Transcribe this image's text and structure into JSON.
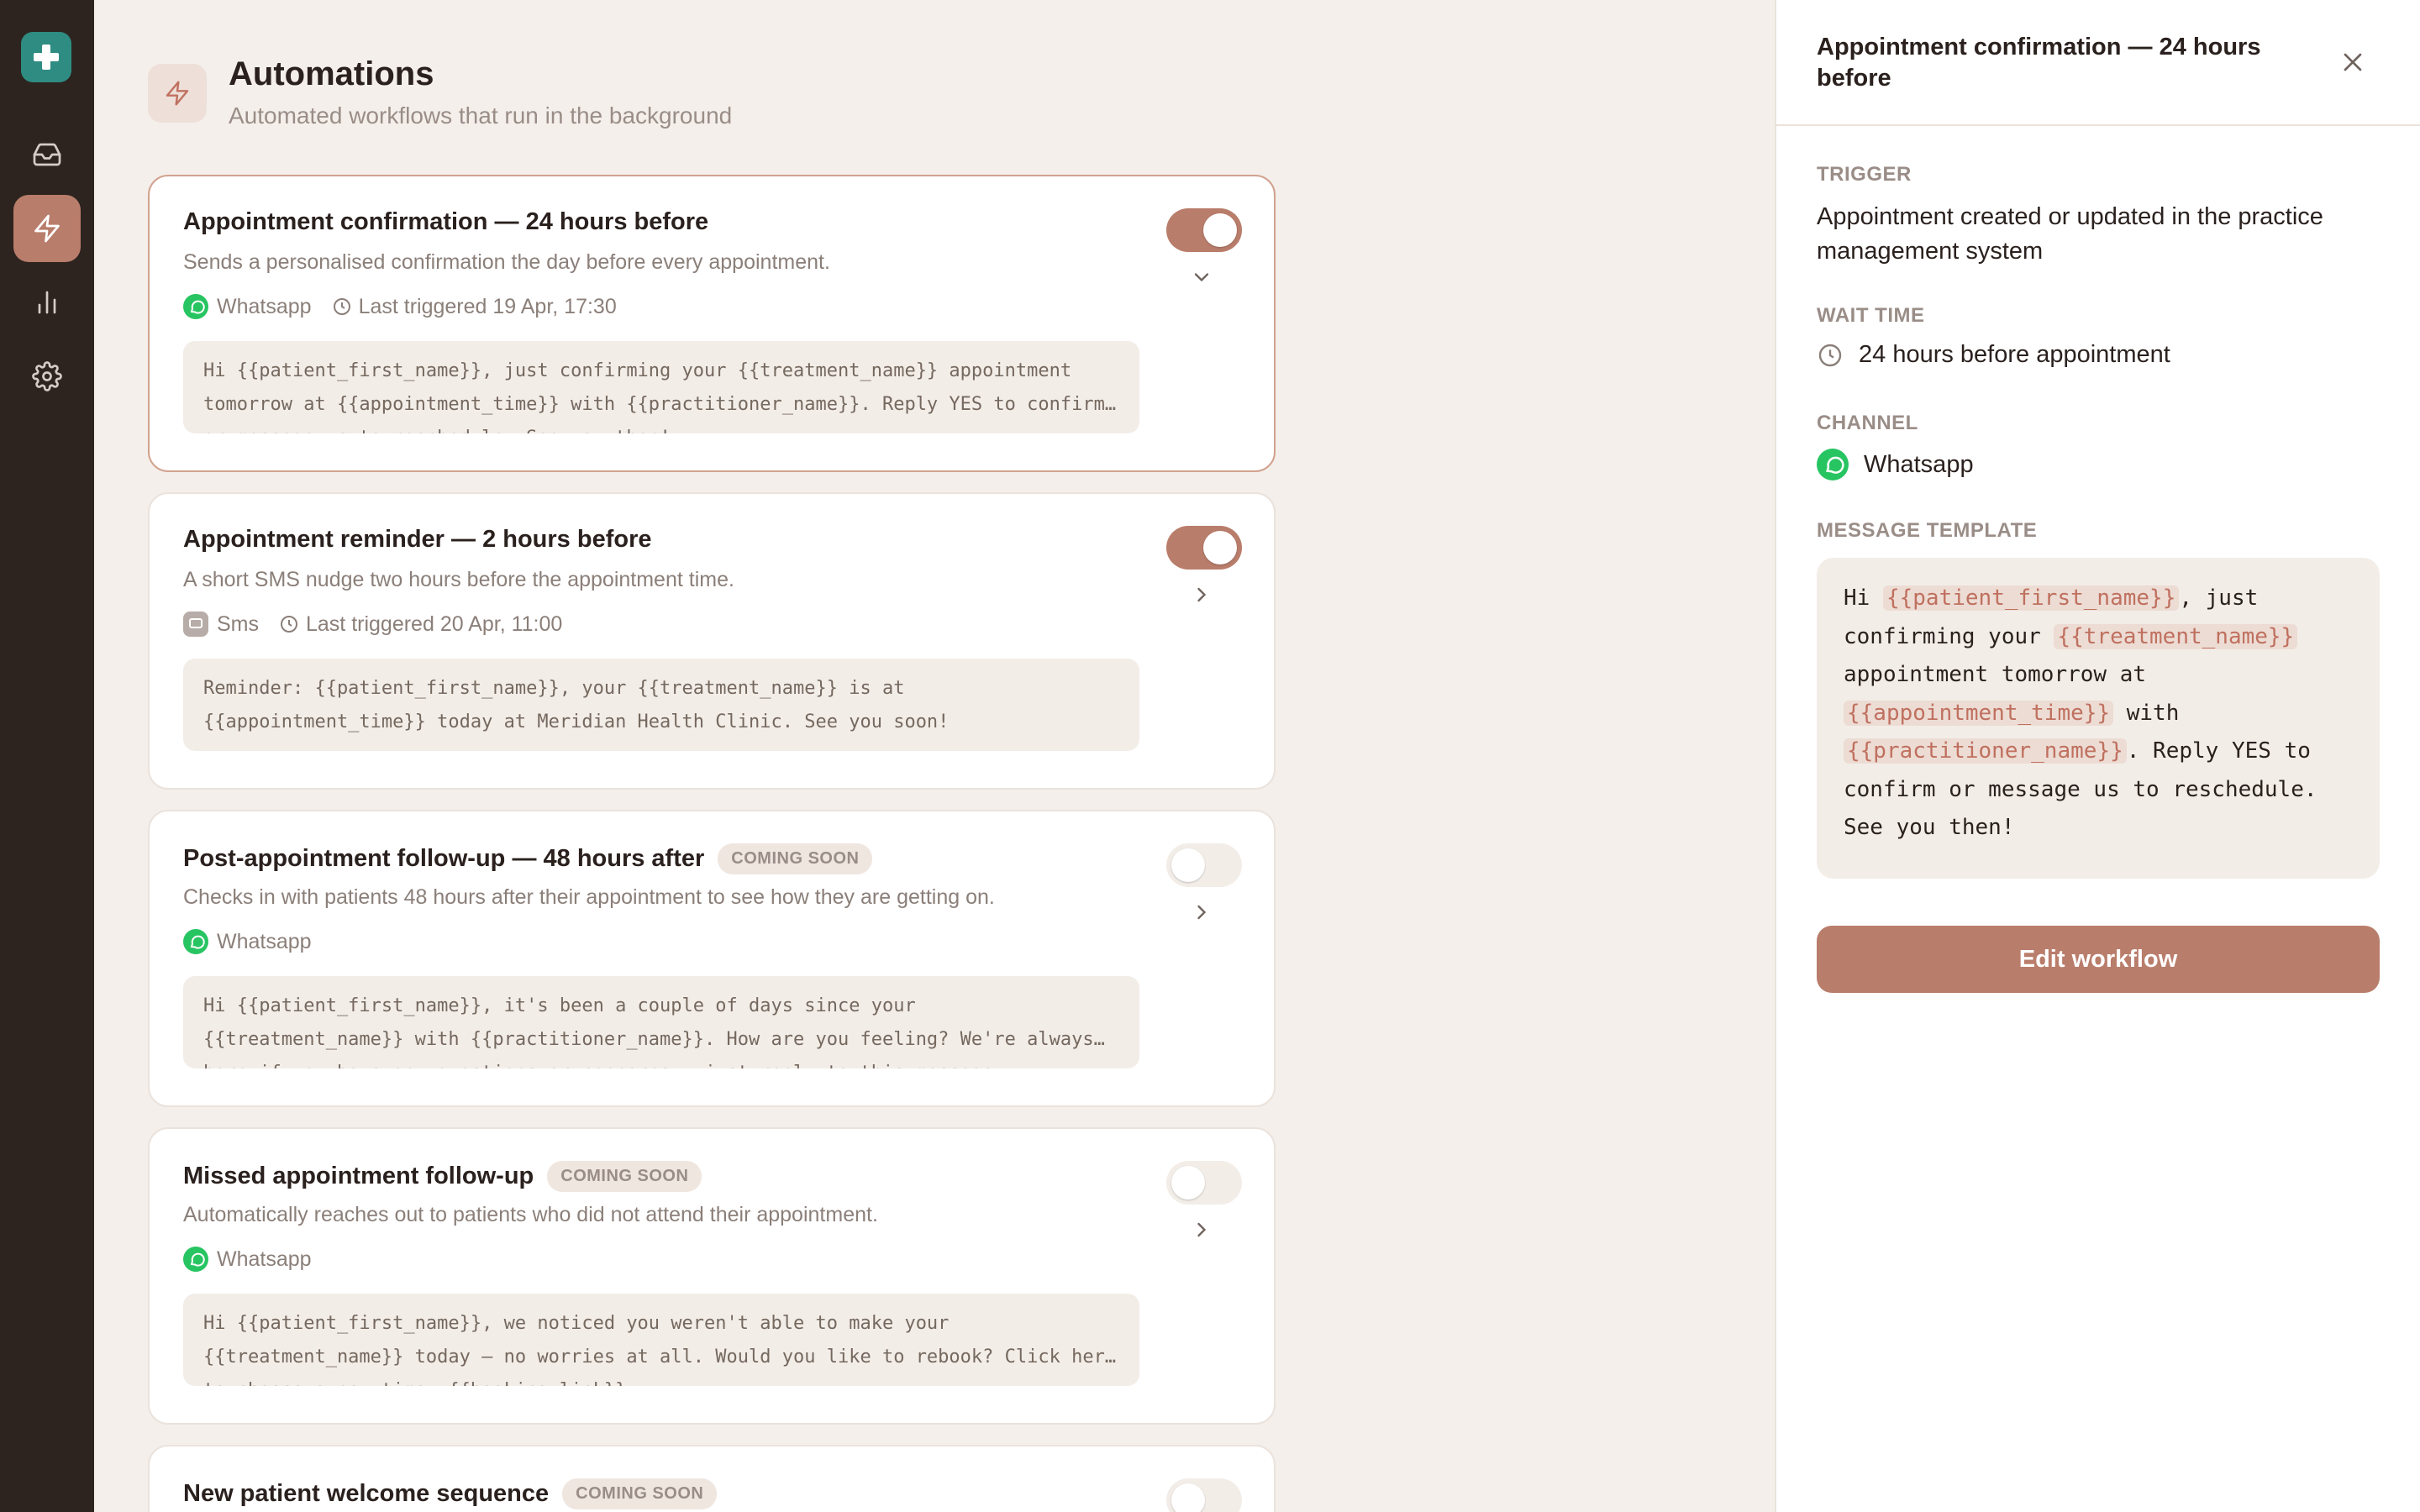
{
  "nav": {
    "items": [
      "inbox-icon",
      "automations-icon",
      "analytics-icon",
      "settings-icon"
    ],
    "active": "automations"
  },
  "page": {
    "title": "Automations",
    "subtitle": "Automated workflows that run in the background"
  },
  "automations": [
    {
      "title": "Appointment confirmation — 24 hours before",
      "badge": "",
      "description": "Sends a personalised confirmation the day before every appointment.",
      "channel": "Whatsapp",
      "last_triggered": "Last triggered 19 Apr, 17:30",
      "template": "Hi {{patient_first_name}}, just confirming your {{treatment_name}} appointment\ntomorrow at {{appointment_time}} with {{practitioner_name}}. Reply YES to confirm…\nor message us to reschedule. See you then!",
      "enabled": true,
      "expanded": true
    },
    {
      "title": "Appointment reminder — 2 hours before",
      "badge": "",
      "description": "A short SMS nudge two hours before the appointment time.",
      "channel": "Sms",
      "last_triggered": "Last triggered 20 Apr, 11:00",
      "template": "Reminder: {{patient_first_name}}, your {{treatment_name}} is at\n{{appointment_time}} today at Meridian Health Clinic. See you soon!",
      "enabled": true,
      "expanded": false
    },
    {
      "title": "Post-appointment follow-up — 48 hours after",
      "badge": "COMING SOON",
      "description": "Checks in with patients 48 hours after their appointment to see how they are getting on.",
      "channel": "Whatsapp",
      "last_triggered": "",
      "template": "Hi {{patient_first_name}}, it's been a couple of days since your\n{{treatment_name}} with {{practitioner_name}}. How are you feeling? We're always…\nhere if you have any questions or concerns — just reply to this message.",
      "enabled": false,
      "expanded": false
    },
    {
      "title": "Missed appointment follow-up",
      "badge": "COMING SOON",
      "description": "Automatically reaches out to patients who did not attend their appointment.",
      "channel": "Whatsapp",
      "last_triggered": "",
      "template": "Hi {{patient_first_name}}, we noticed you weren't able to make your\n{{treatment_name}} today — no worries at all. Would you like to rebook? Click her…\nto choose a new time: {{booking_link}}",
      "enabled": false,
      "expanded": false
    },
    {
      "title": "New patient welcome sequence",
      "badge": "COMING SOON",
      "description": "",
      "channel": "",
      "last_triggered": "",
      "template": "",
      "enabled": false,
      "expanded": false
    }
  ],
  "panel": {
    "title": "Appointment confirmation — 24 hours before",
    "trigger_label": "TRIGGER",
    "trigger_value": "Appointment created or updated in the practice management system",
    "wait_label": "WAIT TIME",
    "wait_value": "24 hours before appointment",
    "channel_label": "CHANNEL",
    "channel_value": "Whatsapp",
    "template_label": "MESSAGE TEMPLATE",
    "template_lines": [
      [
        {
          "t": "Hi "
        },
        {
          "v": "{{patient_first_name}}"
        },
        {
          "t": ", just"
        }
      ],
      [
        {
          "t": "confirming your "
        },
        {
          "v": "{{treatment_name}}"
        }
      ],
      [
        {
          "t": "appointment tomorrow at"
        }
      ],
      [
        {
          "v": "{{appointment_time}}"
        },
        {
          "t": " with"
        }
      ],
      [
        {
          "v": "{{practitioner_name}}"
        },
        {
          "t": ". Reply YES to"
        }
      ],
      [
        {
          "t": "confirm or message us to reschedule."
        }
      ],
      [
        {
          "t": "See you then!"
        }
      ]
    ],
    "edit_button": "Edit workflow"
  },
  "colors": {
    "accent": "#b97d6b",
    "rail": "#2d2420",
    "whatsapp": "#27c462",
    "logo": "#2f8c82",
    "variable": "#c0705f"
  }
}
